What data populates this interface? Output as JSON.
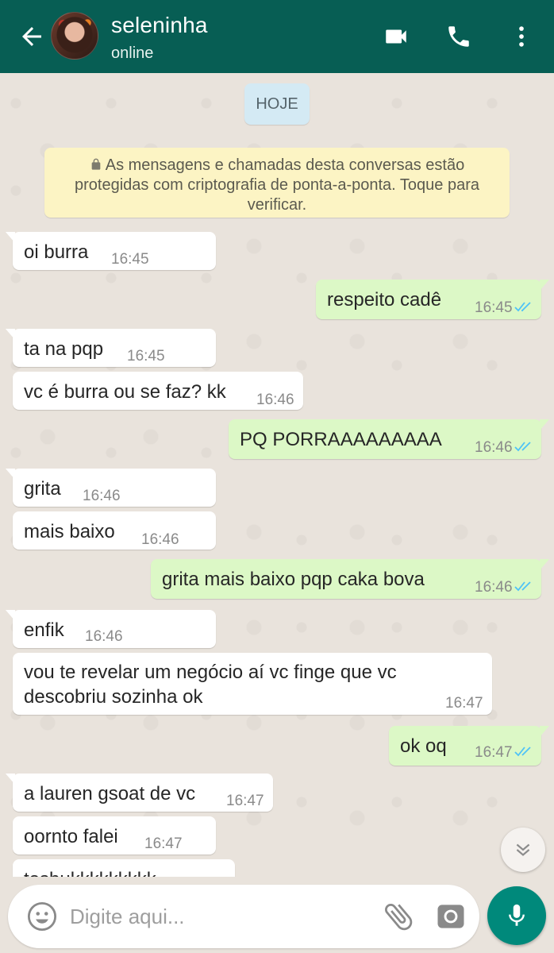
{
  "header": {
    "contact_name": "seleninha",
    "status": "online"
  },
  "date_chip": "HOJE",
  "encryption_notice": "As mensagens e chamadas desta conversas estão protegidas com criptografia de ponta-a-ponta. Toque para verificar.",
  "messages": [
    {
      "dir": "in",
      "text": "oi burra",
      "time": "16:45"
    },
    {
      "dir": "out",
      "text": "respeito cadê",
      "time": "16:45",
      "status": "read"
    },
    {
      "dir": "in",
      "text": "ta na pqp",
      "time": "16:45"
    },
    {
      "dir": "in",
      "text": "vc é burra ou se faz? kk",
      "time": "16:46"
    },
    {
      "dir": "out",
      "text": "PQ PORRAAAAAAAAA",
      "time": "16:46",
      "status": "read"
    },
    {
      "dir": "in",
      "text": "grita",
      "time": "16:46"
    },
    {
      "dir": "in",
      "text": "mais baixo",
      "time": "16:46"
    },
    {
      "dir": "out",
      "text": "grita mais baixo pqp caka bova",
      "time": "16:46",
      "status": "read"
    },
    {
      "dir": "in",
      "text": "enfik",
      "time": "16:46"
    },
    {
      "dir": "in",
      "text_line1": "vou te revelar um negócio aí vc finge que vc",
      "text_line2": "descobriu sozinha ok",
      "time": "16:47"
    },
    {
      "dir": "out",
      "text": "ok oq",
      "time": "16:47",
      "status": "read"
    },
    {
      "dir": "in",
      "text": "a lauren gsoat de vc",
      "time": "16:47"
    },
    {
      "dir": "in",
      "text": "oornto falei",
      "time": "16:47"
    },
    {
      "dir": "in",
      "text": "tosbukkkkkkkkk",
      "time": ""
    }
  ],
  "composer": {
    "placeholder": "Digite aqui..."
  },
  "colors": {
    "header": "#075e54",
    "outgoing_bubble": "#dcf8c6",
    "incoming_bubble": "#ffffff",
    "read_ticks": "#4fc3f7",
    "mic_button": "#00897b"
  },
  "icons": [
    "back-arrow-icon",
    "video-camera-icon",
    "phone-icon",
    "more-vert-icon",
    "lock-icon",
    "double-check-icon",
    "chevron-double-down-icon",
    "emoji-icon",
    "paperclip-icon",
    "camera-icon",
    "microphone-icon"
  ]
}
